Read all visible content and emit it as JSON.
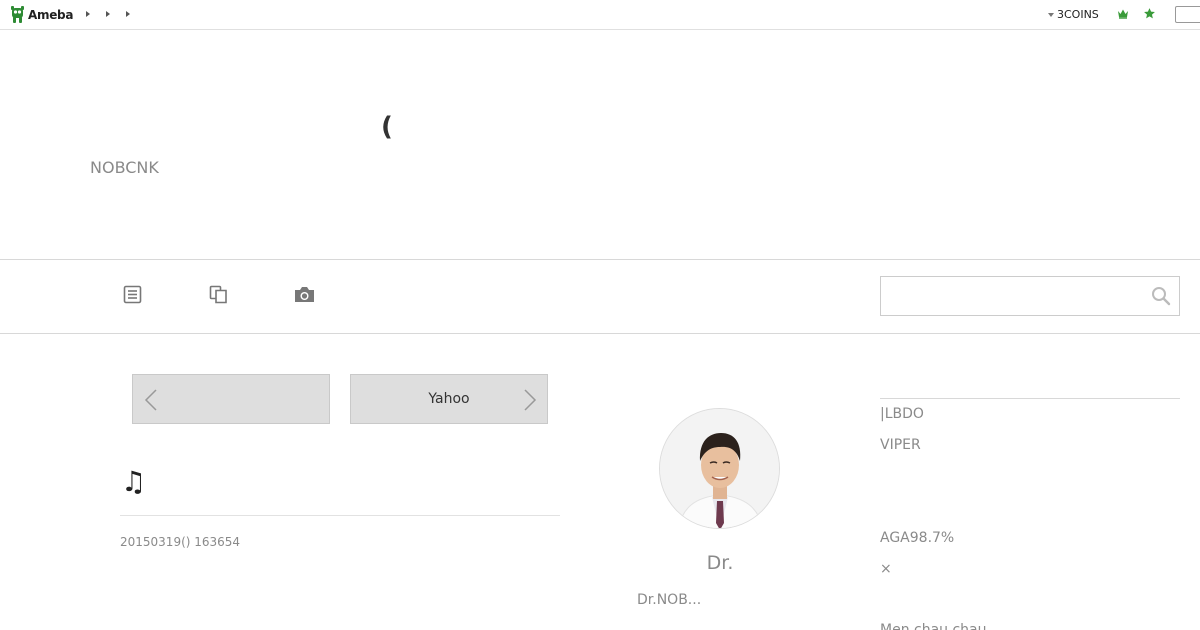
{
  "header": {
    "logo_text": "Ameba",
    "coins_label": "3COINS"
  },
  "blog": {
    "title_char": "(",
    "subtitle": "NOBCNK"
  },
  "search": {
    "value": "",
    "placeholder": ""
  },
  "pager": {
    "prev_label": "",
    "next_label": "Yahoo"
  },
  "article": {
    "title": "♫",
    "date": "20150319() 163654"
  },
  "profile": {
    "name": "Dr.",
    "description": "Dr.NOB..."
  },
  "sidebar": {
    "lines": [
      "|LBDO",
      "VIPER",
      "AGA98.7%",
      "×",
      "Men.chau        chau"
    ]
  },
  "colors": {
    "logo_green": "#2e8b34",
    "text_gray": "#8a8a8a",
    "pager_bg": "#dedede"
  },
  "icons": [
    "ameba-logo-icon",
    "crown-icon",
    "star-icon",
    "article-list-icon",
    "theme-list-icon",
    "camera-icon",
    "search-icon",
    "chevron-left-icon",
    "chevron-right-icon"
  ]
}
